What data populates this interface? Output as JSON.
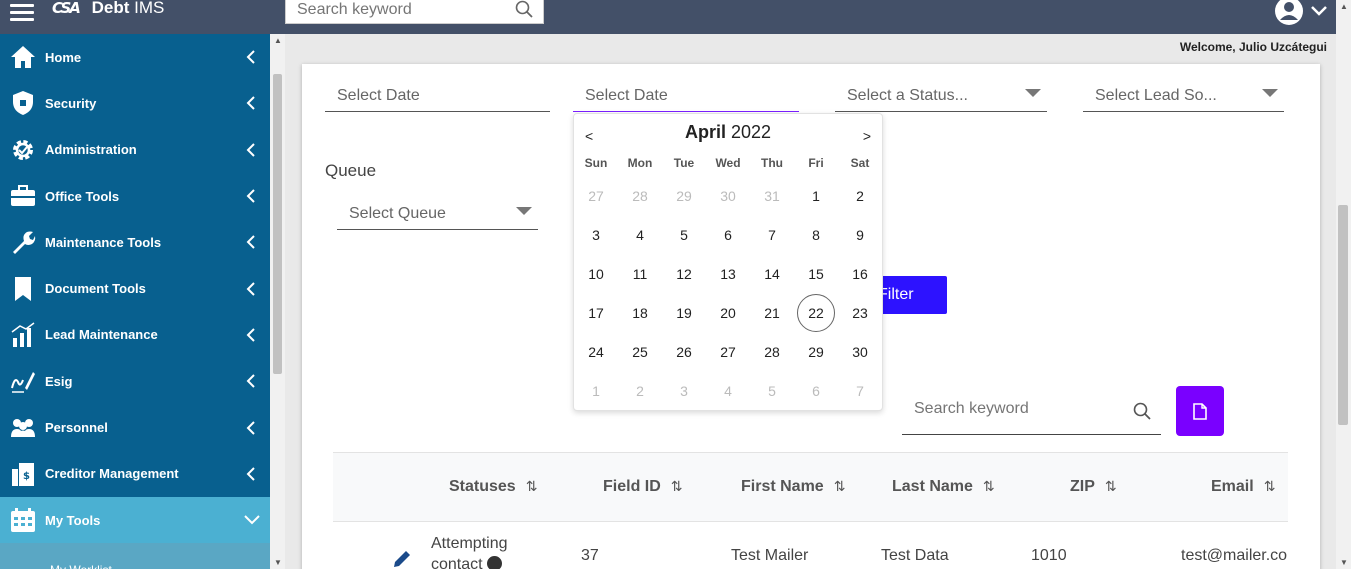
{
  "header": {
    "brand_logo": "CSA",
    "brand_debt": "Debt",
    "brand_ims": "IMS",
    "search_placeholder": "Search keyword"
  },
  "welcome": "Welcome, Julio Uzcátegui",
  "sidebar": {
    "items": [
      {
        "label": "Home",
        "icon": "home-icon"
      },
      {
        "label": "Security",
        "icon": "shield-icon"
      },
      {
        "label": "Administration",
        "icon": "gear-icon"
      },
      {
        "label": "Office Tools",
        "icon": "briefcase-icon"
      },
      {
        "label": "Maintenance Tools",
        "icon": "wrench-icon"
      },
      {
        "label": "Document Tools",
        "icon": "bookmark-icon"
      },
      {
        "label": "Lead Maintenance",
        "icon": "chart-icon"
      },
      {
        "label": "Esig",
        "icon": "signature-icon"
      },
      {
        "label": "Personnel",
        "icon": "people-icon"
      },
      {
        "label": "Creditor Management",
        "icon": "building-icon"
      },
      {
        "label": "My Tools",
        "icon": "calendar-icon"
      }
    ],
    "sub_item": "My Worklist"
  },
  "filters": {
    "date_from": "Select Date",
    "date_to": "Select Date",
    "status": "Select a Status...",
    "lead_source": "Select Lead So...",
    "queue_label": "Queue",
    "queue": "Select Queue",
    "filter_button": "Filter"
  },
  "calendar": {
    "prev": "<",
    "next": ">",
    "month": "April",
    "year": "2022",
    "weekdays": [
      "Sun",
      "Mon",
      "Tue",
      "Wed",
      "Thu",
      "Fri",
      "Sat"
    ],
    "weeks": [
      [
        "27",
        "28",
        "29",
        "30",
        "31",
        "1",
        "2"
      ],
      [
        "3",
        "4",
        "5",
        "6",
        "7",
        "8",
        "9"
      ],
      [
        "10",
        "11",
        "12",
        "13",
        "14",
        "15",
        "16"
      ],
      [
        "17",
        "18",
        "19",
        "20",
        "21",
        "22",
        "23"
      ],
      [
        "24",
        "25",
        "26",
        "27",
        "28",
        "29",
        "30"
      ],
      [
        "1",
        "2",
        "3",
        "4",
        "5",
        "6",
        "7"
      ]
    ],
    "today": "22"
  },
  "table": {
    "search_placeholder": "Search keyword",
    "columns": [
      "Statuses",
      "Field ID",
      "First Name",
      "Last Name",
      "ZIP",
      "Email"
    ],
    "sort_glyph": "⇅",
    "rows": [
      {
        "status_line1": "Attempting",
        "status_line2": "contact",
        "field_id": "37",
        "first_name": "Test Mailer",
        "last_name": "Test Data",
        "zip": "1010",
        "email": "test@mailer.co"
      }
    ]
  },
  "colors": {
    "topbar": "#435068",
    "sidebar": "#08608f",
    "sidebar_active": "#4bb0d2",
    "filter_button": "#2d12ff",
    "export_button": "#7a00ff"
  }
}
